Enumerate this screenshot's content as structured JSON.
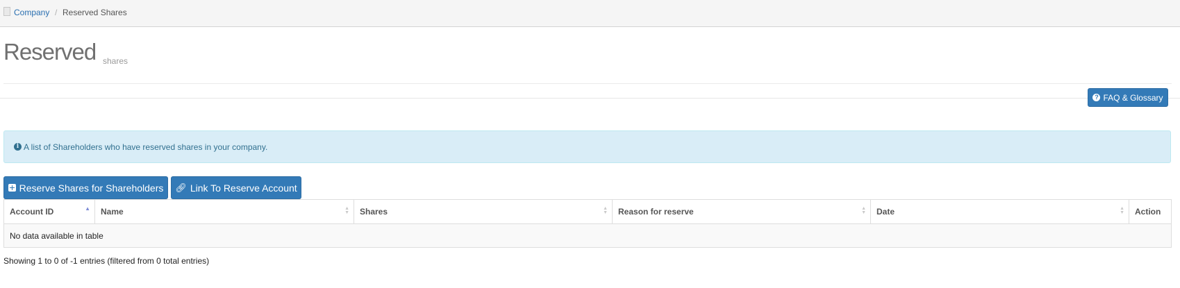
{
  "breadcrumb": {
    "home_icon": "page-icon",
    "items": [
      {
        "label": "Company"
      },
      {
        "label": "Reserved Shares"
      }
    ],
    "separator": "/"
  },
  "header": {
    "title": "Reserved",
    "subtitle": "shares"
  },
  "faq_button": {
    "icon": "question-circle-icon",
    "label": "FAQ & Glossary"
  },
  "info_alert": {
    "icon": "info-circle-icon",
    "text": "A list of Shareholders who have reserved shares in your company."
  },
  "actions": {
    "reserve_label": "Reserve Shares for Shareholders",
    "reserve_icon": "plus-square-icon",
    "link_label": "Link To Reserve Account",
    "link_icon": "link-icon"
  },
  "table": {
    "columns": [
      {
        "label": "Account ID",
        "sort": "asc"
      },
      {
        "label": "Name",
        "sort": "none"
      },
      {
        "label": "Shares",
        "sort": "none"
      },
      {
        "label": "Reason for reserve",
        "sort": "none"
      },
      {
        "label": "Date",
        "sort": "none"
      },
      {
        "label": "Action",
        "sort": "disabled"
      }
    ],
    "empty_message": "No data available in table"
  },
  "footer": {
    "info": "Showing 1 to 0 of -1 entries (filtered from 0 total entries)"
  },
  "colors": {
    "primary": "#337ab7",
    "info_bg": "#d9edf7",
    "info_text": "#31708f",
    "link": "#2a6fb0"
  }
}
